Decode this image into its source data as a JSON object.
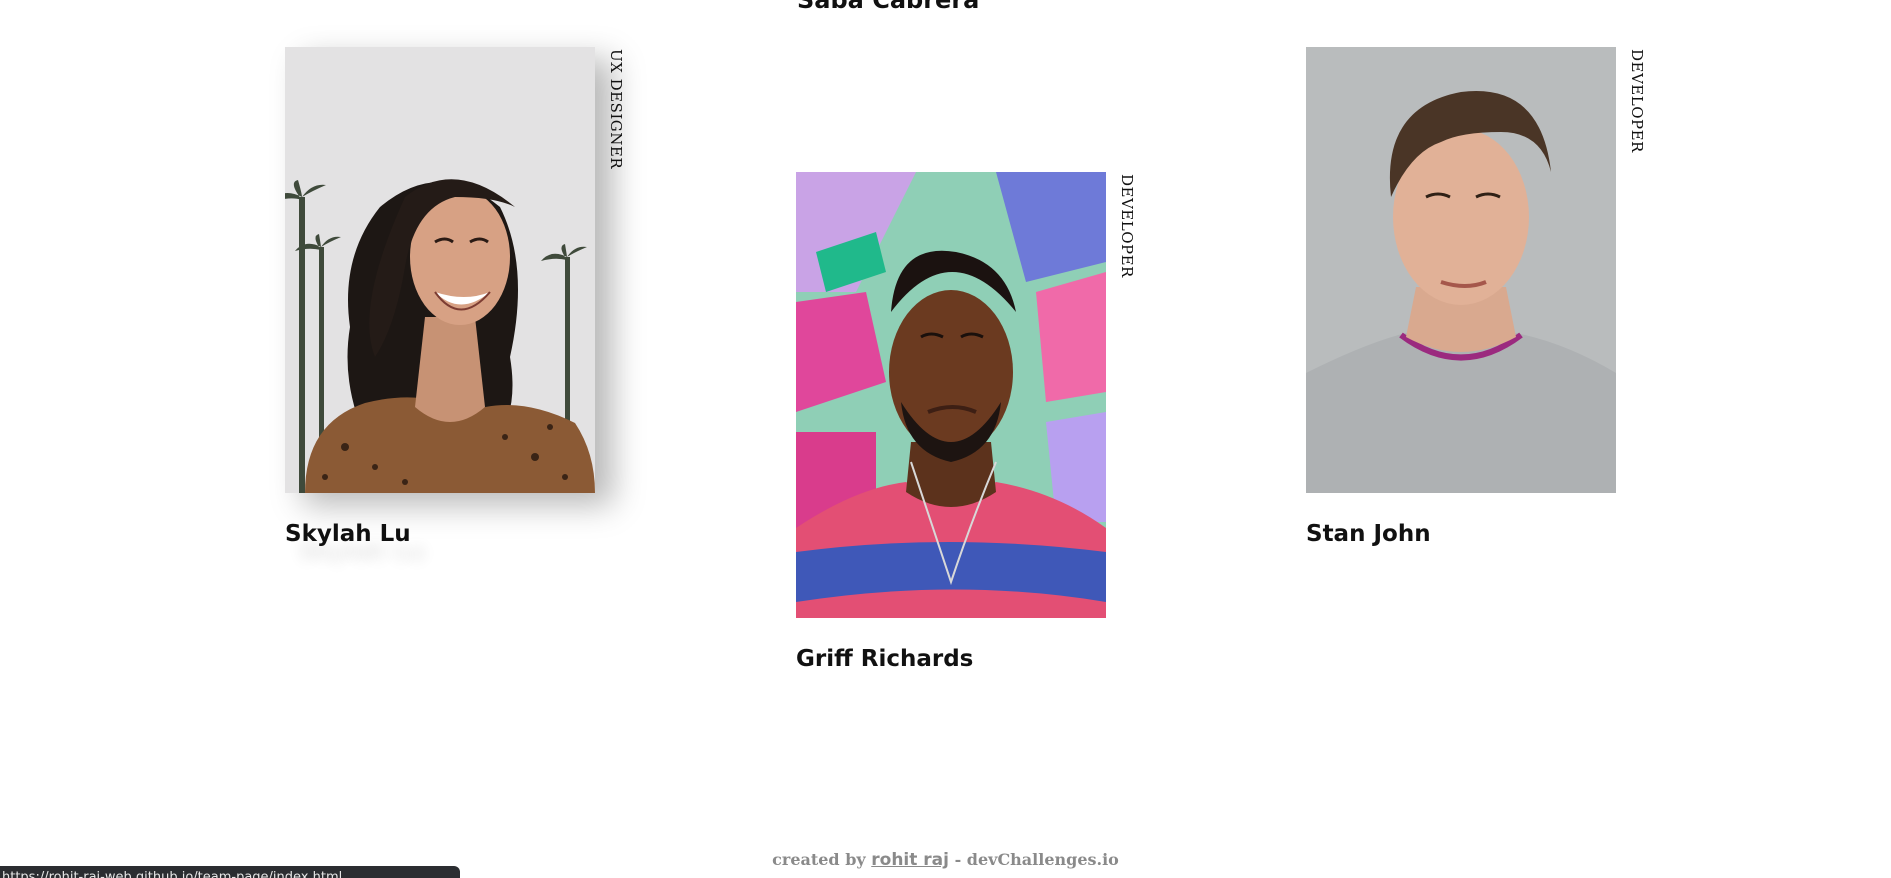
{
  "top_cut_name": "Saba Cabrera",
  "members": [
    {
      "name": "Skylah Lu",
      "role": "UX DESIGNER",
      "photo": "smiling-woman-portrait"
    },
    {
      "name": "Griff Richards",
      "role": "DEVELOPER",
      "photo": "man-graffiti-portrait"
    },
    {
      "name": "Stan John",
      "role": "DEVELOPER",
      "photo": "man-grey-sweater-portrait"
    }
  ],
  "footer": {
    "prefix": "created by",
    "author": "rohit raj",
    "suffix": "- devChallenges.io"
  },
  "status_bar": {
    "url": "https://rohit-raj-web.github.io/team-page/index.html"
  },
  "colors": {
    "text": "#111111",
    "footer_text": "#8a8a8a",
    "status_bg": "#2b2d31"
  }
}
